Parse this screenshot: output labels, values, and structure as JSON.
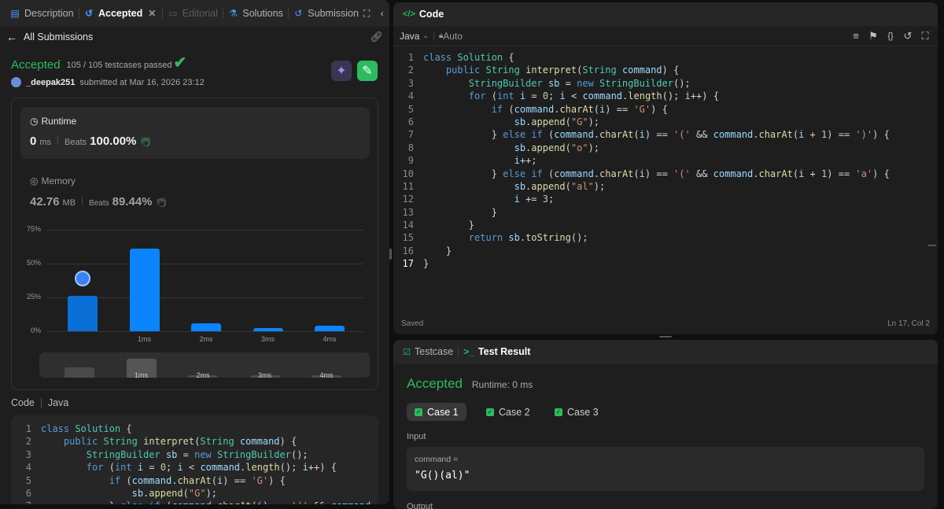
{
  "tabs": {
    "description": "Description",
    "accepted": "Accepted",
    "editorial": "Editorial",
    "solutions": "Solutions",
    "submissions": "Submission"
  },
  "submission": {
    "back_label": "All Submissions",
    "status": "Accepted",
    "testcases": "105 / 105 testcases passed",
    "username": "_deepak251",
    "submitted_at": "submitted at Mar 16, 2026 23:12"
  },
  "runtime": {
    "title": "Runtime",
    "value": "0",
    "unit": "ms",
    "beats_label": "Beats",
    "beats_value": "100.00%"
  },
  "memory": {
    "title": "Memory",
    "value": "42.76",
    "unit": "MB",
    "beats_label": "Beats",
    "beats_value": "89.44%"
  },
  "chart_data": {
    "type": "bar",
    "y_ticks": [
      "75%",
      "50%",
      "25%",
      "0%"
    ],
    "ylim": [
      0,
      75
    ],
    "categories": [
      "",
      "1ms",
      "2ms",
      "3ms",
      "4ms"
    ],
    "values": [
      26,
      61,
      6,
      2.5,
      4
    ],
    "highlight_index": 0,
    "mini_labels": [
      "1ms",
      "2ms",
      "3ms",
      "4ms"
    ],
    "mini_values": [
      0.55,
      1.0,
      0.12,
      0.1,
      0.12
    ],
    "accent": "#0a84ff"
  },
  "left_code": {
    "label": "Code",
    "lang": "Java"
  },
  "editor": {
    "title": "Code",
    "language": "Java",
    "auto_label": "Auto",
    "status": "Saved",
    "cursor": "Ln 17, Col 2"
  },
  "code_lines": [
    "class Solution {",
    "    public String interpret(String command) {",
    "        StringBuilder sb = new StringBuilder();",
    "        for (int i = 0; i < command.length(); i++) {",
    "            if (command.charAt(i) == 'G') {",
    "                sb.append(\"G\");",
    "            } else if (command.charAt(i) == '(' && command.charAt(i + 1) == ')') {",
    "                sb.append(\"o\");",
    "                i++;",
    "            } else if (command.charAt(i) == '(' && command.charAt(i + 1) == 'a') {",
    "                sb.append(\"al\");",
    "                i += 3;",
    "            }",
    "        }",
    "        return sb.toString();",
    "    }",
    "}"
  ],
  "result": {
    "testcase_tab": "Testcase",
    "result_tab": "Test Result",
    "status": "Accepted",
    "runtime": "Runtime: 0 ms",
    "cases": [
      "Case 1",
      "Case 2",
      "Case 3"
    ],
    "input_label": "Input",
    "var_name": "command =",
    "var_value": "\"G()(al)\"",
    "output_label": "Output"
  },
  "colors": {
    "accepted": "#2cbb5d",
    "accent": "#0a84ff",
    "panel": "#1e1e1e"
  }
}
